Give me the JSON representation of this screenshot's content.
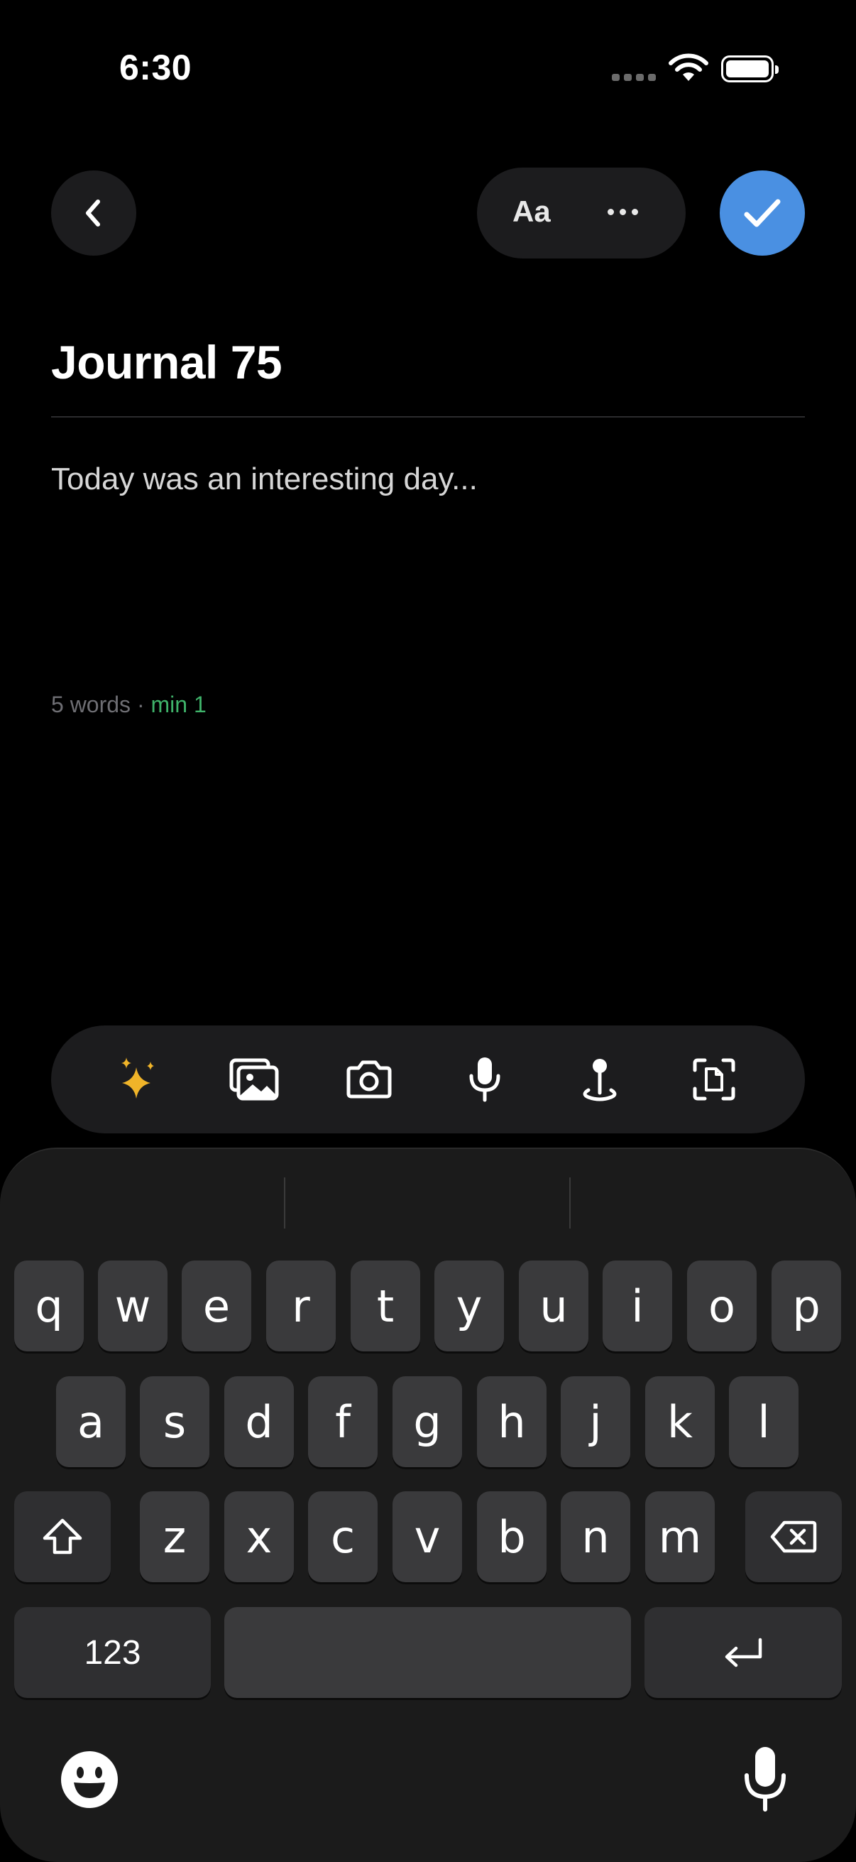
{
  "status_bar": {
    "time": "6:30",
    "icons": [
      "signal-icon",
      "wifi-icon",
      "battery-icon"
    ]
  },
  "nav": {
    "back_icon": "chevron-left-icon",
    "format_label": "Aa",
    "more_icon": "ellipsis-icon",
    "done_icon": "checkmark-icon",
    "accent": "#4a90e2"
  },
  "entry": {
    "title": "Journal 75",
    "body": "Today was an interesting day...",
    "word_count": "5 words",
    "separator": " · ",
    "minimum": "min 1",
    "minimum_color": "#3fb36a"
  },
  "toolbar": {
    "items": [
      "sparkles-icon",
      "photos-icon",
      "camera-icon",
      "microphone-icon",
      "location-pin-icon",
      "scan-document-icon"
    ]
  },
  "keyboard": {
    "row1": [
      "q",
      "w",
      "e",
      "r",
      "t",
      "y",
      "u",
      "i",
      "o",
      "p"
    ],
    "row2": [
      "a",
      "s",
      "d",
      "f",
      "g",
      "h",
      "j",
      "k",
      "l"
    ],
    "row3": [
      "z",
      "x",
      "c",
      "v",
      "b",
      "n",
      "m"
    ],
    "numbers_label": "123",
    "shift_icon": "shift-icon",
    "delete_icon": "delete-icon",
    "return_icon": "return-icon",
    "emoji_icon": "emoji-icon",
    "dictation_icon": "microphone-icon"
  }
}
